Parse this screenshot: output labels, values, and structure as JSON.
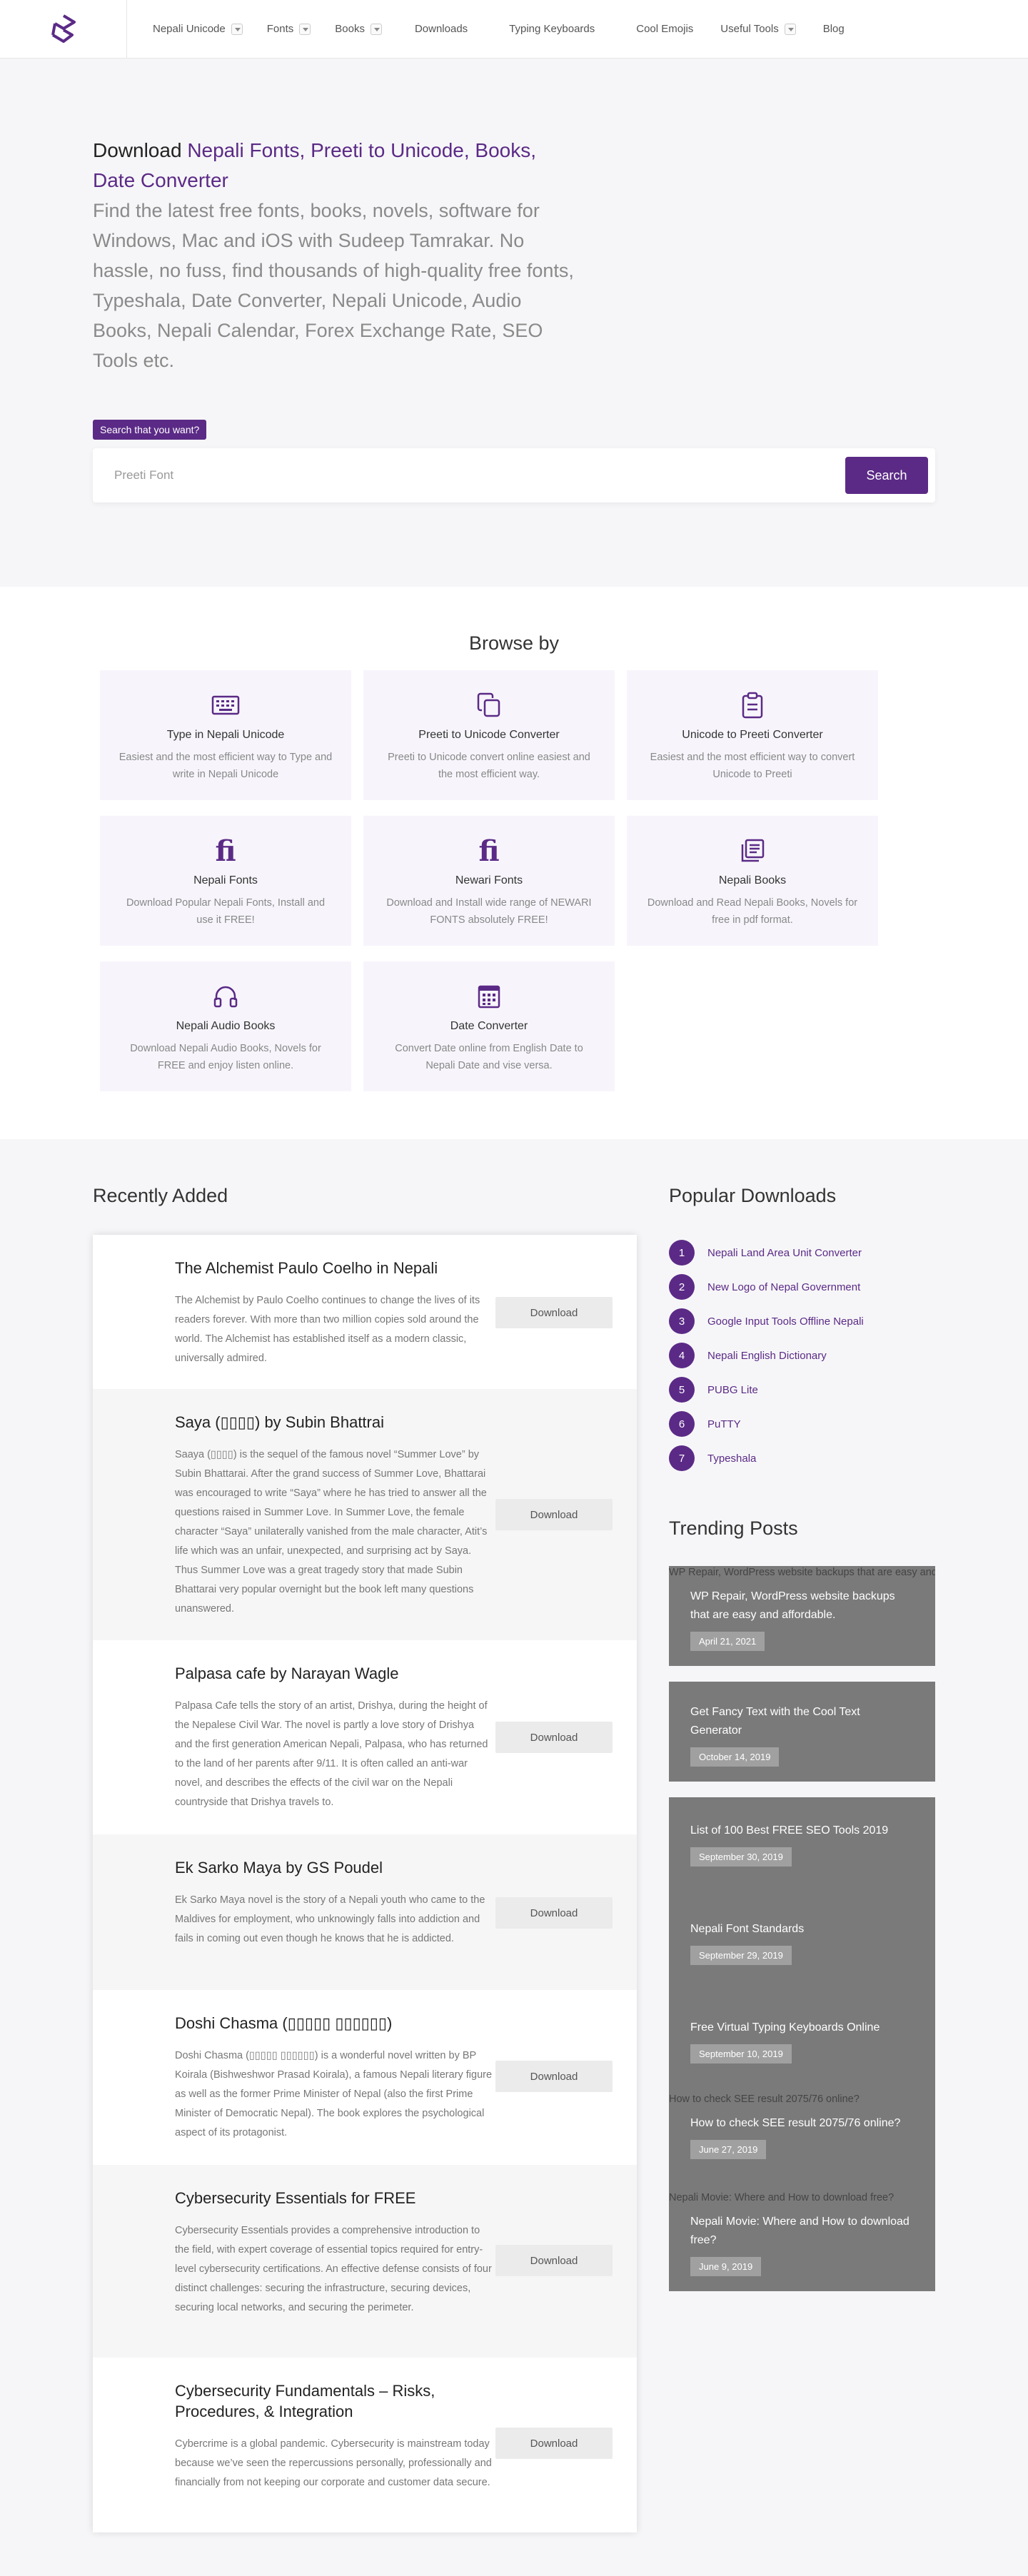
{
  "nav": {
    "items": [
      {
        "label": "Nepali Unicode",
        "dropdown": true
      },
      {
        "label": "Fonts",
        "dropdown": true
      },
      {
        "label": "Books",
        "dropdown": true
      },
      {
        "label": "Downloads",
        "dropdown": false
      },
      {
        "label": "Typing Keyboards",
        "dropdown": false
      },
      {
        "label": "Cool Emojis",
        "dropdown": false
      },
      {
        "label": "Useful Tools",
        "dropdown": true
      },
      {
        "label": "Blog",
        "dropdown": false
      }
    ]
  },
  "hero": {
    "prefix": "Download ",
    "link1": "Nepali Fonts",
    "sep1": ", ",
    "link2": "Preeti to Unicode",
    "sep2": ", ",
    "link3": "Books",
    "sep3": ", ",
    "link4": "Date Converter",
    "lead": "Find the latest free fonts, books, novels, software for Windows, Mac and iOS with Sudeep Tamrakar. No hassle, no fuss, find thousands of high-quality free fonts, Typeshala, Date Converter, Nepali Unicode, Audio Books, Nepali Calendar, Forex Exchange Rate, SEO Tools etc.",
    "search_label": "Search that you want?",
    "search_placeholder": "Preeti Font",
    "search_button": "Search"
  },
  "browse": {
    "title": "Browse by",
    "cards": [
      {
        "icon": "keyboard-icon",
        "title": "Type in Nepali Unicode",
        "desc": "Easiest and the most efficient way to Type and write in Nepali Unicode"
      },
      {
        "icon": "copy-icon",
        "title": "Preeti to Unicode Converter",
        "desc": "Preeti to Unicode convert online easiest and the most efficient way."
      },
      {
        "icon": "clipboard-icon",
        "title": "Unicode to Preeti Converter",
        "desc": "Easiest and the most efficient way to convert Unicode to Preeti"
      },
      {
        "icon": "font-ligature-icon",
        "title": "Nepali Fonts",
        "desc": "Download Popular Nepali Fonts, Install and use it FREE!"
      },
      {
        "icon": "font-ligature-icon",
        "title": "Newari Fonts",
        "desc": "Download and Install wide range of NEWARI FONTS absolutely FREE!"
      },
      {
        "icon": "book-icon",
        "title": "Nepali Books",
        "desc": "Download and Read Nepali Books, Novels for free in pdf format."
      },
      {
        "icon": "headphones-icon",
        "title": "Nepali Audio Books",
        "desc": "Download Nepali Audio Books, Novels for FREE and enjoy listen online."
      },
      {
        "icon": "calendar-icon",
        "title": "Date Converter",
        "desc": "Convert Date online from English Date to Nepali Date and vise versa."
      }
    ]
  },
  "recent": {
    "title": "Recently Added",
    "download_label": "Download",
    "posts": [
      {
        "title": "The Alchemist Paulo Coelho in Nepali",
        "text": "The Alchemist by Paulo Coelho continues to change the lives of its readers forever. With more than two million copies sold around the world. The Alchemist has established itself as a modern classic, universally admired."
      },
      {
        "title": "Saya (▯▯▯▯) by Subin Bhattrai",
        "text": "Saaya (▯▯▯▯) is the sequel of the famous novel “Summer Love” by Subin Bhattarai. After the grand success of Summer Love, Bhattarai was encouraged to write “Saya” where he has tried to answer all the questions raised in Summer Love. In Summer Love, the female character “Saya” unilaterally vanished from the male character, Atit’s life which was an unfair, unexpected, and surprising act by Saya. Thus Summer Love was a great tragedy story that made Subin Bhattarai very popular overnight but the book left many questions unanswered."
      },
      {
        "title": "Palpasa cafe by Narayan Wagle",
        "text": "Palpasa Cafe tells the story of an artist, Drishya, during the height of the Nepalese Civil War. The novel is partly a love story of Drishya and the first generation American Nepali, Palpasa, who has returned to the land of her parents after 9/11. It is often called an anti-war novel, and describes the effects of the civil war on the Nepali countryside that Drishya travels to."
      },
      {
        "title": "Ek Sarko Maya by GS Poudel",
        "text": "Ek Sarko Maya novel is the story of a Nepali youth who came to the Maldives for employment, who unknowingly falls into addiction and fails in coming out even though he knows that he is addicted."
      },
      {
        "title": "Doshi Chasma (▯▯▯▯▯ ▯▯▯▯▯▯)",
        "text": "Doshi Chasma (▯▯▯▯▯ ▯▯▯▯▯▯) is a wonderful novel written by BP Koirala (Bishweshwor Prasad Koirala), a famous Nepali literary figure as well as the former Prime Minister of Nepal (also the first Prime Minister of Democratic Nepal). The book explores the psychological aspect of its protagonist."
      },
      {
        "title": "Cybersecurity Essentials for FREE",
        "text": "Cybersecurity Essentials provides a comprehensive introduction to the field, with expert coverage of essential topics required for entry-level cybersecurity certifications. An effective defense consists of four distinct challenges: securing the infrastructure, securing devices, securing local networks, and securing the perimeter."
      },
      {
        "title": "Cybersecurity Fundamentals – Risks, Procedures, & Integration",
        "text": "Cybercrime is a global pandemic. Cybersecurity is mainstream today because we’ve seen the repercussions personally, professionally and financially from not keeping our corporate and customer data secure."
      }
    ]
  },
  "popular": {
    "title": "Popular Downloads",
    "items": [
      {
        "num": "1",
        "label": "Nepali Land Area Unit Converter"
      },
      {
        "num": "2",
        "label": "New Logo of Nepal Government"
      },
      {
        "num": "3",
        "label": "Google Input Tools Offline Nepali"
      },
      {
        "num": "4",
        "label": "Nepali English Dictionary"
      },
      {
        "num": "5",
        "label": "PUBG Lite"
      },
      {
        "num": "6",
        "label": "PuTTY"
      },
      {
        "num": "7",
        "label": "Typeshala"
      }
    ]
  },
  "trending": {
    "title": "Trending Posts",
    "posts": [
      {
        "alt": "WP Repair, WordPress website backups that are easy and affordable.",
        "title": "WP Repair, WordPress website backups that are easy and affordable.",
        "date": "April 21, 2021"
      },
      {
        "alt": "",
        "title": "Get Fancy Text with the Cool Text Generator",
        "date": "October 14, 2019"
      },
      {
        "alt": "",
        "title": "List of 100 Best FREE SEO Tools 2019",
        "date": "September 30, 2019"
      },
      {
        "alt": "",
        "title": "Nepali Font Standards",
        "date": "September 29, 2019"
      },
      {
        "alt": "",
        "title": "Free Virtual Typing Keyboards Online",
        "date": "September 10, 2019"
      },
      {
        "alt": "How to check SEE result 2075/76 online?",
        "title": "How to check SEE result 2075/76 online?",
        "date": "June 27, 2019"
      },
      {
        "alt": "Nepali Movie: Where and How to download free?",
        "title": "Nepali Movie: Where and How to download free?",
        "date": "June 9, 2019"
      }
    ]
  },
  "colors": {
    "brand": "#5b2a86",
    "hero_bg": "#f6f6f8",
    "card_bg": "#f7f5fb"
  }
}
